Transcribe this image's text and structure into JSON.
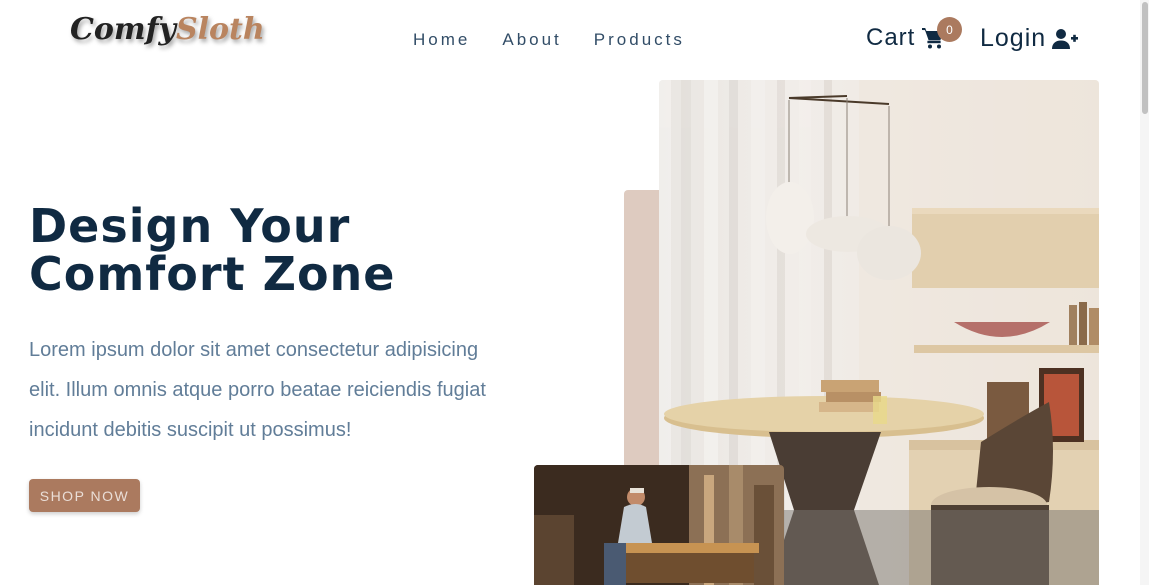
{
  "brand": {
    "part1": "Comfy",
    "part2": "Sloth"
  },
  "nav": {
    "links": [
      {
        "label": "Home"
      },
      {
        "label": "About"
      },
      {
        "label": "Products"
      }
    ]
  },
  "cart": {
    "label": "Cart",
    "count": "0",
    "icon": "cart-icon"
  },
  "login": {
    "label": "Login",
    "icon": "user-plus-icon"
  },
  "hero": {
    "title_line1": "Design Your",
    "title_line2": "Comfort Zone",
    "text_line1": "Lorem ipsum dolor sit amet consectetur adipisicing",
    "text_line2": "elit. Illum omnis atque porro beatae reiciendis fugiat",
    "text_line3": "incidunt debitis suscipit ut possimus!",
    "button": "SHOP NOW"
  },
  "colors": {
    "primary": "#ab7a5f",
    "heading": "#102a42",
    "text": "#617d98",
    "accent_block": "#decbc0"
  }
}
